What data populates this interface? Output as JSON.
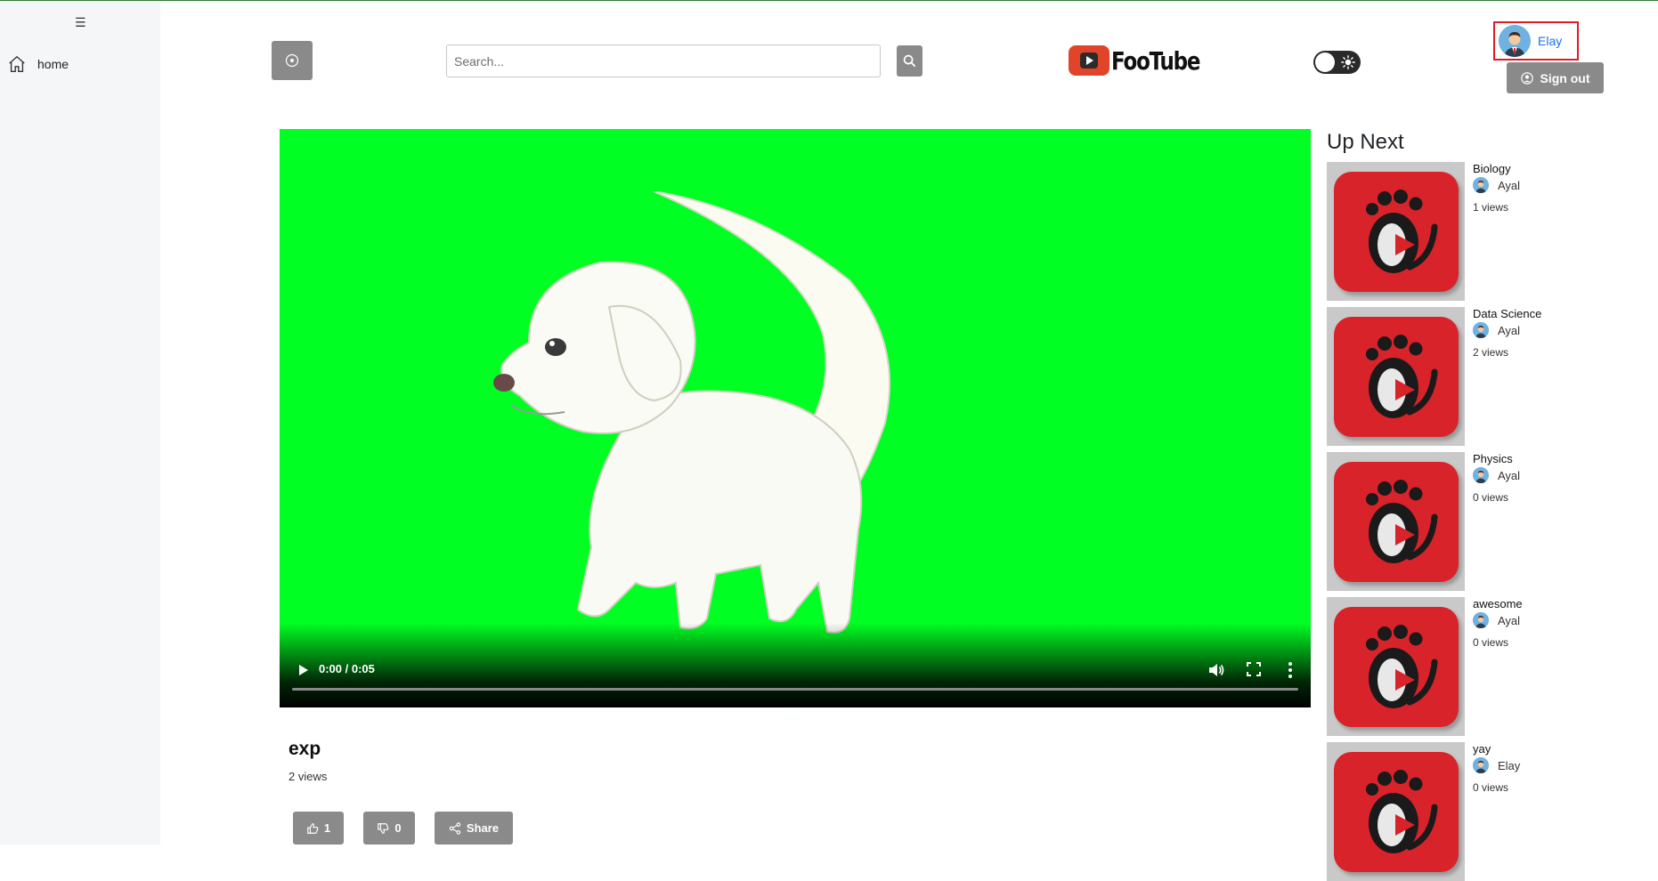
{
  "sidebar": {
    "menu_icon": "☰",
    "items": [
      {
        "label": "home",
        "icon": "home-icon"
      }
    ]
  },
  "header": {
    "search_placeholder": "Search...",
    "logo_text": "FooTube",
    "user_name": "Elay",
    "signout_label": "Sign out"
  },
  "video": {
    "time": "0:00 / 0:05",
    "title": "exp",
    "views": "2 views",
    "likes": "1",
    "dislikes": "0",
    "share_label": "Share"
  },
  "up_next": {
    "title": "Up Next",
    "items": [
      {
        "title": "Biology",
        "author": "Ayal",
        "views": "1 views"
      },
      {
        "title": "Data Science",
        "author": "Ayal",
        "views": "2 views"
      },
      {
        "title": "Physics",
        "author": "Ayal",
        "views": "0 views"
      },
      {
        "title": "awesome",
        "author": "Ayal",
        "views": "0 views"
      },
      {
        "title": "yay",
        "author": "Elay",
        "views": "0 views"
      }
    ]
  },
  "colors": {
    "video_background": "#00ff22",
    "button_gray": "#8a8a8a",
    "highlight_border": "#e01b24",
    "link_blue": "#1a73e8"
  }
}
